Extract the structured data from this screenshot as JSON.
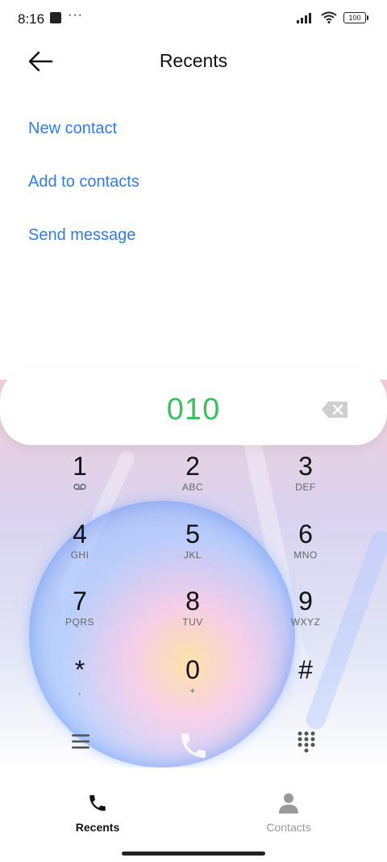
{
  "status_bar": {
    "time": "8:16",
    "more": "···",
    "battery": "100"
  },
  "header": {
    "title": "Recents"
  },
  "actions": [
    {
      "label": "New contact"
    },
    {
      "label": "Add to contacts"
    },
    {
      "label": "Send message"
    }
  ],
  "dialer": {
    "number": "010",
    "keys": [
      {
        "digit": "1",
        "letters": ""
      },
      {
        "digit": "2",
        "letters": "ABC"
      },
      {
        "digit": "3",
        "letters": "DEF"
      },
      {
        "digit": "4",
        "letters": "GHI"
      },
      {
        "digit": "5",
        "letters": "JKL"
      },
      {
        "digit": "6",
        "letters": "MNO"
      },
      {
        "digit": "7",
        "letters": "PQRS"
      },
      {
        "digit": "8",
        "letters": "TUV"
      },
      {
        "digit": "9",
        "letters": "WXYZ"
      },
      {
        "digit": "*",
        "letters": ","
      },
      {
        "digit": "0",
        "letters": "+"
      },
      {
        "digit": "#",
        "letters": ""
      }
    ]
  },
  "bottom_nav": {
    "recents": "Recents",
    "contacts": "Contacts"
  },
  "colors": {
    "accent": "#2f7de1",
    "number": "#36c15d"
  }
}
